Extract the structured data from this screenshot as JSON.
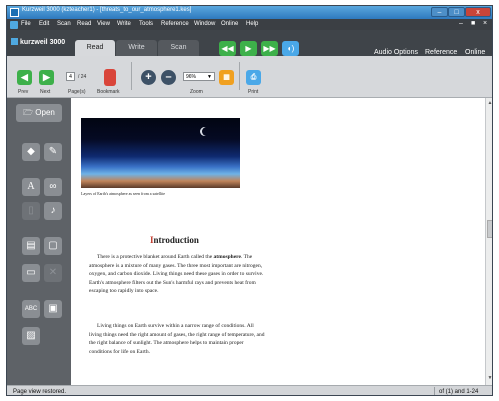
{
  "window": {
    "title": "Kurzweil 3000 (kzteacher1) - [threats_to_our_atmosphere1.kes]",
    "min_glyph": "–",
    "max_glyph": "□",
    "close_glyph": "x"
  },
  "menu": {
    "items": [
      "File",
      "Edit",
      "Scan",
      "Read",
      "View",
      "Write",
      "Tools",
      "Reference",
      "Window",
      "Online",
      "Help"
    ],
    "right_min": "–",
    "right_max": "■",
    "right_close": "×"
  },
  "tabbar": {
    "brand": "kurzweil 3000",
    "tabs": [
      "Read",
      "Write",
      "Scan"
    ],
    "audio_options": "Audio Options",
    "reference": "Reference",
    "online": "Online"
  },
  "toolbar": {
    "prev_label": "Prev",
    "next_label": "Next",
    "pages_label": "Page(s)",
    "page_current": "4",
    "page_total": "/ 24",
    "bookmark_label": "Bookmark",
    "zoom_value": "96%",
    "zoom_label": "Zoom",
    "print_label": "Print"
  },
  "sidebar": {
    "open_label": "Open"
  },
  "document": {
    "caption": "Layers of Earth's atmosphere as seen from a satellite",
    "heading_first": "I",
    "heading_rest": "ntroduction",
    "p1_a": "There is a protective blanket around Earth called the ",
    "p1_bold": "atmosphere",
    "p1_b": ". The atmosphere is a mixture of many gases. The three most important are nitrogen, oxygen, and carbon dioxide. Living things need these gases in order to survive. Earth's atmosphere filters out the Sun's harmful rays and prevents heat from escaping too rapidly into space.",
    "p2": "Living things on Earth survive within a narrow range of conditions. All living things need the right amount of gases, the right range of temperature, and the right balance of sunlight. The atmosphere helps to maintain proper conditions for life on Earth."
  },
  "status": {
    "message": "Page view restored.",
    "page_info": "of (1) and 1-24"
  },
  "colors": {
    "accent_green": "#3db04a",
    "accent_blue": "#4aa8e8",
    "bookmark_red": "#d9453a",
    "zoom_fit_orange": "#f0a020"
  }
}
